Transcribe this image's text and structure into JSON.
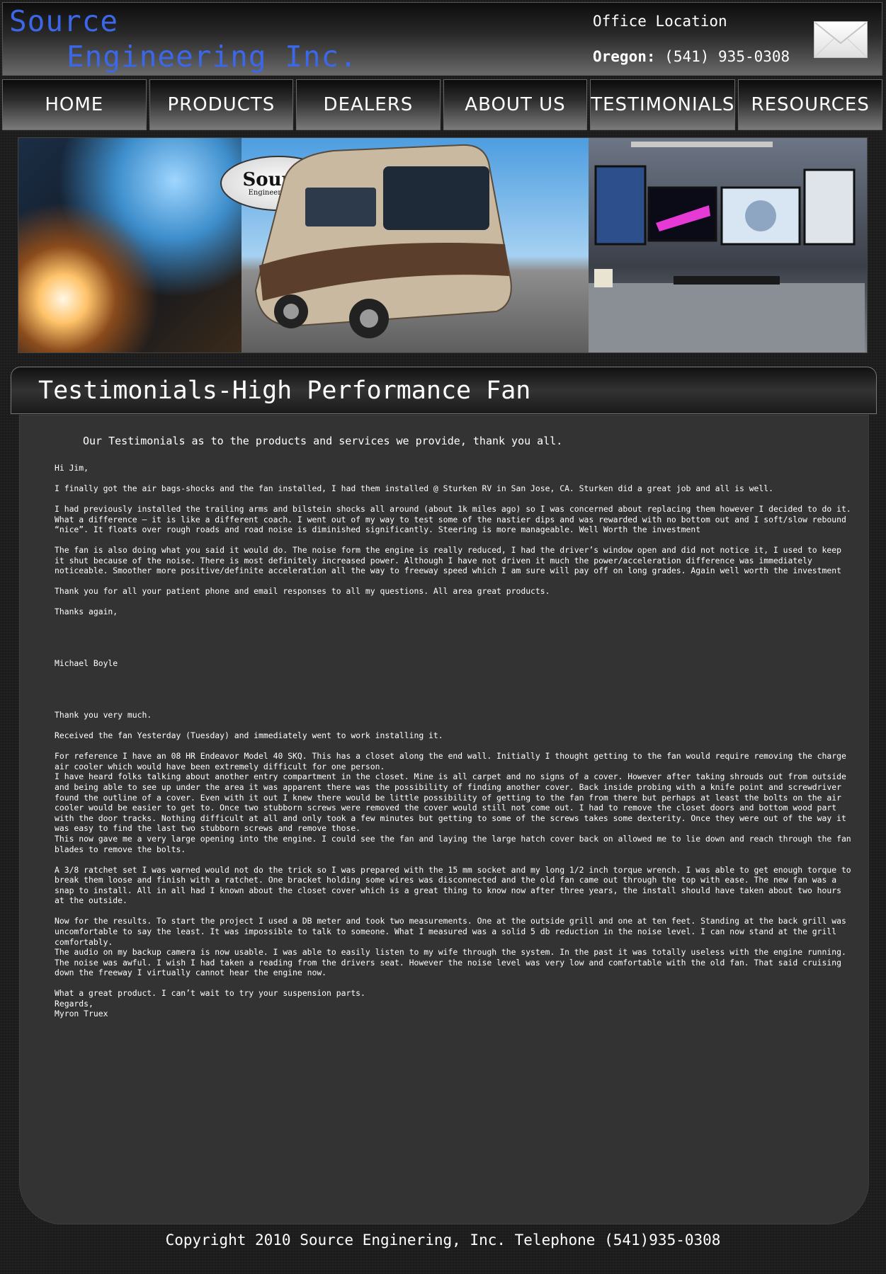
{
  "header": {
    "logo_line1": "Source",
    "logo_line2": "Engineering Inc.",
    "office_label": "Office Location",
    "oregon_label": "Oregon:",
    "oregon_phone": "(541) 935-0308",
    "mail_icon": "envelope-icon"
  },
  "nav": [
    {
      "label": "HOME"
    },
    {
      "label": "PRODUCTS"
    },
    {
      "label": "DEALERS"
    },
    {
      "label": "ABOUT US"
    },
    {
      "label": "TESTIMONIALS"
    },
    {
      "label": "RESOURCES"
    }
  ],
  "banner": {
    "logo_big": "Source",
    "logo_small": "Engineering Inc."
  },
  "page": {
    "title": "Testimonials-High Performance Fan",
    "intro": "Our Testimonials as to the products and services we provide, thank you all."
  },
  "letter1": {
    "p1": "Hi Jim,",
    "p2": "I finally got the air bags-shocks and the fan installed, I had them installed @ Sturken RV in San Jose, CA.  Sturken did a great job and all is well.",
    "p3": "I had previously installed the trailing arms and bilstein shocks all around (about 1k miles ago) so I was concerned about replacing them however I decided to do it.  What a difference – it is like a different coach. I went out of my way to test some of the nastier dips and was rewarded with no bottom out and I soft/slow rebound “nice”.  It floats over rough roads and road noise is diminished significantly.  Steering is more manageable.   Well Worth the investment",
    "p4": "The fan is also doing what you said it would do.  The noise form the engine is really reduced, I had the driver’s window open and did not notice it, I used to keep it shut because of the noise.  There is most definitely increased power.  Although I have not driven it much the power/acceleration difference was immediately noticeable.  Smoother more positive/definite acceleration all the way to freeway speed which I am sure will pay off on long grades.  Again well worth the investment",
    "p5": "Thank you for all your patient phone and email responses to all my questions.  All area great products.",
    "p6": "Thanks again,",
    "sig": "Michael Boyle"
  },
  "letter2": {
    "p1": "Thank you very much.",
    "p2": "Received the fan Yesterday (Tuesday) and immediately went to work installing it.",
    "p3": "For reference I have an 08 HR Endeavor Model 40 SKQ. This has a closet along the end wall. Initially I thought getting to the fan would require removing the charge air cooler which would have been extremely difficult for one person.\nI have heard folks talking about another entry compartment in the closet. Mine is all carpet and no signs of a cover. However after taking shrouds out from outside and being able to see up under the area it was apparent there was the possibility of finding another cover. Back inside probing with a knife point and screwdriver found the outline of a cover. Even with it out I knew there would be little possibility of getting to the fan from there but perhaps at least the bolts on the air cooler would be easier to get to. Once two stubborn screws were removed the cover would still not come out. I had to remove the closet doors and bottom wood part with the door tracks. Nothing difficult at all and only took a few minutes but getting to some of the screws takes some dexterity. Once they were out of the way it was easy to find the last two stubborn screws and remove those.\nThis now gave me a very large opening into the engine. I could see the fan and laying the large hatch cover back on allowed me to lie down and reach through the fan blades to remove the bolts.",
    "p4": "A 3/8 ratchet set I was warned would not do the trick so I was prepared with the 15 mm socket and my long 1/2 inch torque wrench. I was able to get enough torque to break them loose and finish with a ratchet. One bracket holding some wires was disconnected and the old fan came out through the top with ease. The new fan was a snap to install. All in all had I known about the closet cover which is a great thing to know now after three years, the install should have taken about two hours at the outside.",
    "p5": "Now for the results. To start the project I used a DB meter and took two measurements. One at the outside grill and one at ten feet. Standing at the back grill was uncomfortable to say the least. It was impossible to talk to someone. What I measured was a solid 5 db reduction in the noise level. I can now stand at the grill comfortably.\nThe audio on my backup camera is now usable. I was able to easily listen to my wife through the system. In the past it was totally useless with the engine running. The noise was awful. I wish I had taken a reading from the drivers seat. However the noise level was very low and comfortable with the old fan. That said cruising down the freeway I virtually cannot hear the engine now.",
    "p6": "What a great product. I can’t wait to try your suspension parts.\nRegards,\nMyron Truex"
  },
  "footer": {
    "text": "Copyright 2010 Source Enginering, Inc. Telephone (541)935-0308"
  }
}
